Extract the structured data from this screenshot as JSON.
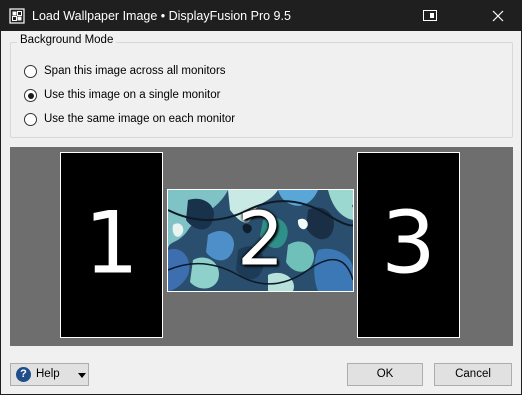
{
  "window": {
    "title": "Load Wallpaper Image • DisplayFusion Pro 9.5",
    "app_icon": "displayfusion-icon",
    "titlebar_color": "#1f1f1f"
  },
  "background_mode": {
    "legend": "Background Mode",
    "options": [
      {
        "label": "Span this image across all monitors",
        "checked": false
      },
      {
        "label": "Use this image on a single monitor",
        "checked": true
      },
      {
        "label": "Use the same image on each monitor",
        "checked": false
      }
    ]
  },
  "preview": {
    "background_color": "#6e6e6e",
    "monitors": [
      {
        "number": "1",
        "has_wallpaper": false
      },
      {
        "number": "2",
        "has_wallpaper": true
      },
      {
        "number": "3",
        "has_wallpaper": false
      }
    ]
  },
  "buttons": {
    "help": "Help",
    "ok": "OK",
    "cancel": "Cancel"
  }
}
